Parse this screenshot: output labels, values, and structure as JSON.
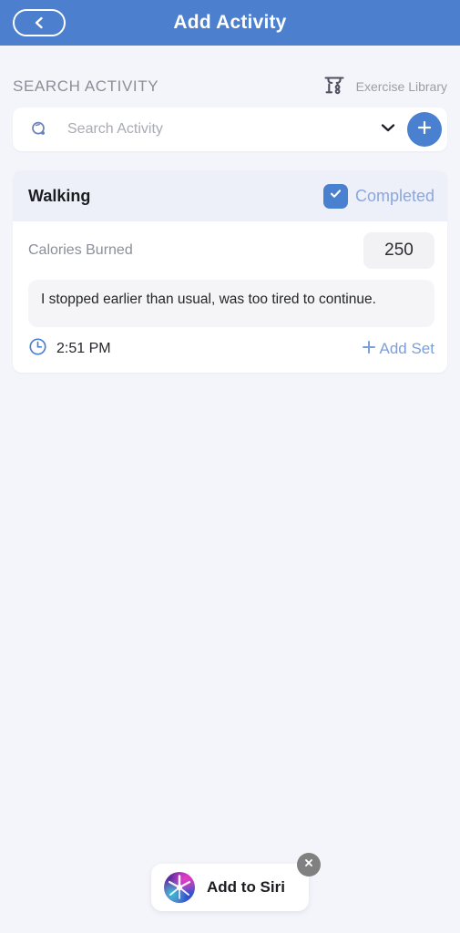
{
  "header": {
    "title": "Add Activity",
    "back_icon": "chevron-left-icon",
    "background_color": "#4c7fcd"
  },
  "search_section": {
    "section_label": "SEARCH ACTIVITY",
    "library_label": "Exercise Library",
    "library_icon": "gym-rack-icon",
    "search_icon": "search-icon",
    "search_value": "",
    "search_placeholder": "Search Activity",
    "dropdown_icon": "chevron-down-icon",
    "add_icon": "plus-icon",
    "add_button_color": "#4a80d0"
  },
  "activity": {
    "name": "Walking",
    "completed_label": "Completed",
    "completed_checked": true,
    "checkbox_color": "#4a80d0",
    "completed_text_color": "#8ba7dc",
    "metric_label": "Calories Burned",
    "metric_value": "250",
    "note_text": "I stopped earlier than usual, was too tired to continue.",
    "time_icon": "clock-icon",
    "time_label": "2:51 PM",
    "add_set_label": "Add Set",
    "add_set_icon": "plus-icon",
    "add_set_color": "#7b9fd8"
  },
  "siri": {
    "label": "Add to Siri",
    "orb_icon": "siri-orb-icon",
    "close_icon": "close-icon",
    "close_color": "#808080"
  }
}
